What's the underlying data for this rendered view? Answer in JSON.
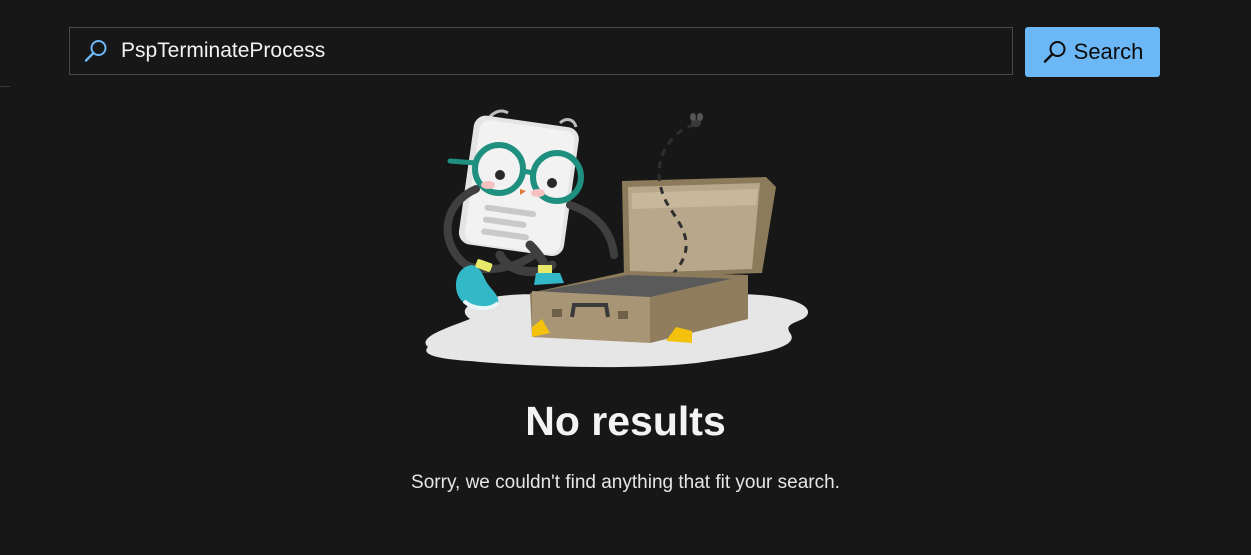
{
  "search": {
    "query": "PspTerminateProcess",
    "icon": "search-icon",
    "button_label": "Search",
    "button_icon": "search-icon",
    "button_color": "#6cb8f6"
  },
  "empty_state": {
    "illustration": "document-character-with-open-suitcase",
    "title": "No results",
    "message": "Sorry, we couldn't find anything that fit your search."
  },
  "colors": {
    "background": "#171717",
    "accent": "#6cb8f6"
  }
}
